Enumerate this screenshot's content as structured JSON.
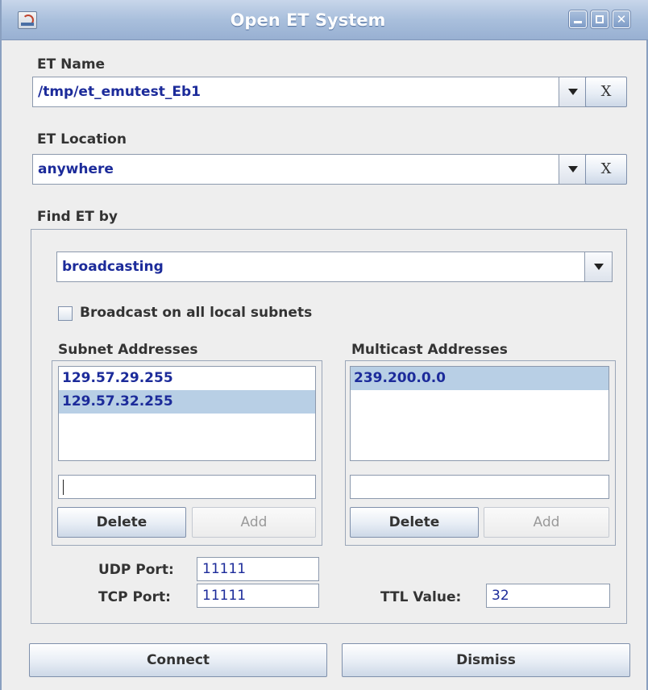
{
  "window": {
    "title": "Open ET System"
  },
  "et_name": {
    "label": "ET Name",
    "value": "/tmp/et_emutest_Eb1",
    "clear_label": "X"
  },
  "et_location": {
    "label": "ET Location",
    "value": "anywhere",
    "clear_label": "X"
  },
  "find": {
    "label": "Find ET by",
    "method": "broadcasting",
    "broadcast_all_label": "Broadcast on all local subnets",
    "broadcast_all_checked": false
  },
  "subnet": {
    "label": "Subnet Addresses",
    "items": [
      {
        "value": "129.57.29.255",
        "selected": false
      },
      {
        "value": "129.57.32.255",
        "selected": true
      }
    ],
    "input_value": "",
    "delete_label": "Delete",
    "add_label": "Add"
  },
  "multicast": {
    "label": "Multicast Addresses",
    "items": [
      {
        "value": "239.200.0.0",
        "selected": true
      }
    ],
    "input_value": "",
    "delete_label": "Delete",
    "add_label": "Add"
  },
  "ports": {
    "udp_label": "UDP Port:",
    "udp_value": "11111",
    "tcp_label": "TCP Port:",
    "tcp_value": "11111",
    "ttl_label": "TTL Value:",
    "ttl_value": "32"
  },
  "actions": {
    "connect_label": "Connect",
    "dismiss_label": "Dismiss"
  }
}
